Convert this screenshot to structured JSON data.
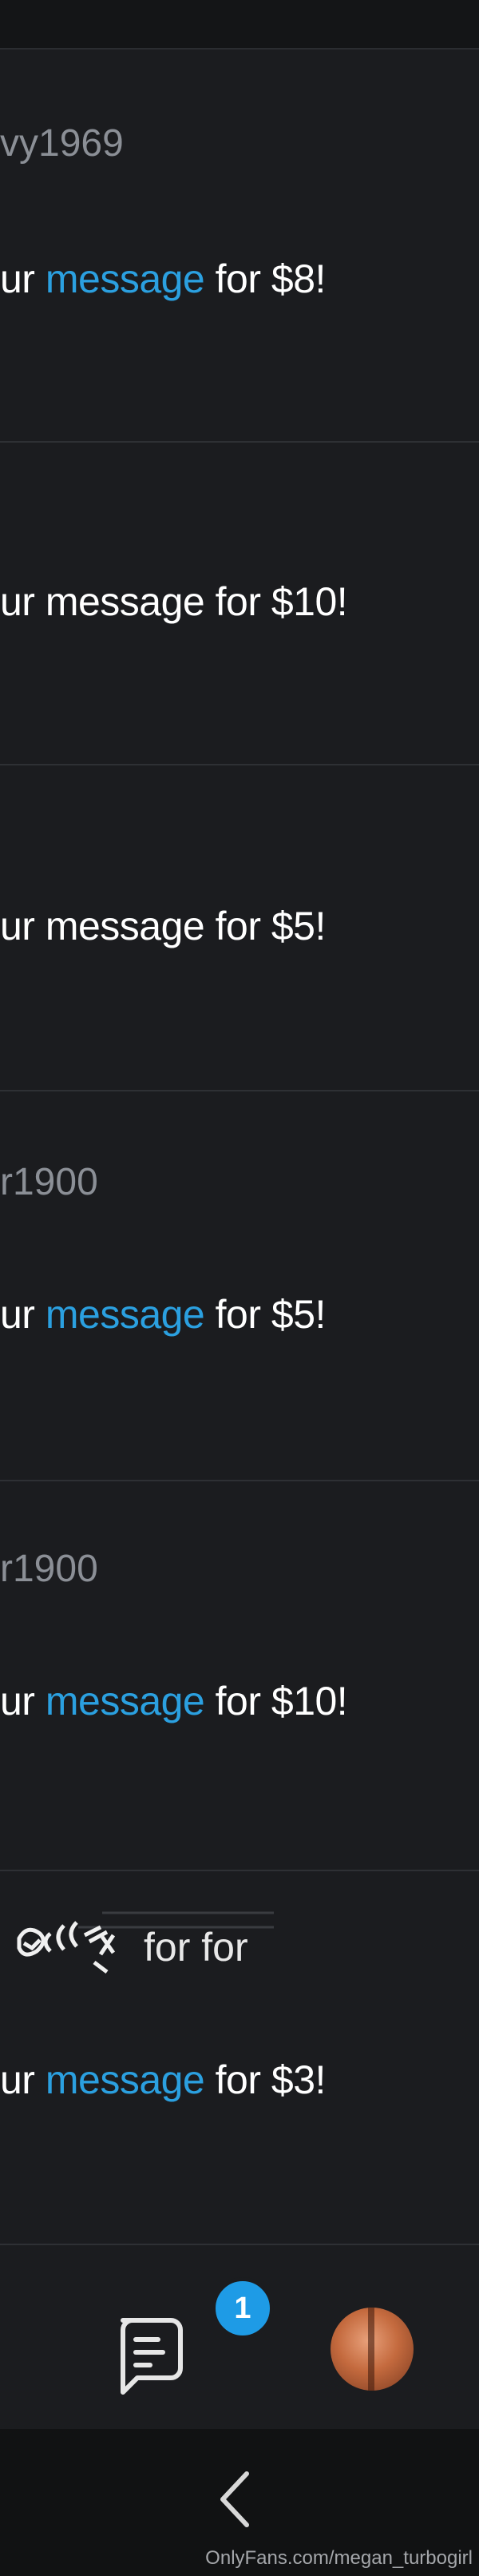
{
  "messages": [
    {
      "username": "vy1969",
      "prefix": "ur ",
      "link": "message",
      "suffix": " for $8!"
    },
    {
      "username": "",
      "prefix": "ur message",
      "link": "",
      "suffix": " for $10!"
    },
    {
      "username": "",
      "prefix": "ur message",
      "link": "",
      "suffix": " for $5!"
    },
    {
      "username": "r1900",
      "prefix": "ur ",
      "link": "message",
      "suffix": " for $5!"
    },
    {
      "username": "r1900",
      "prefix": "ur ",
      "link": "message",
      "suffix": " for $10!"
    },
    {
      "scribble": "for for",
      "prefix": "ur ",
      "link": "message",
      "suffix": " for $3!"
    }
  ],
  "bottom_nav": {
    "unread_badge": "1"
  },
  "watermark": "OnlyFans.com/megan_turbogirl",
  "colors": {
    "background": "#1b1c1f",
    "link": "#2ba0e0",
    "badge": "#1e9be6",
    "username": "#8b8f96"
  },
  "icons": [
    "messages-icon",
    "avatar",
    "back-chevron-icon"
  ]
}
